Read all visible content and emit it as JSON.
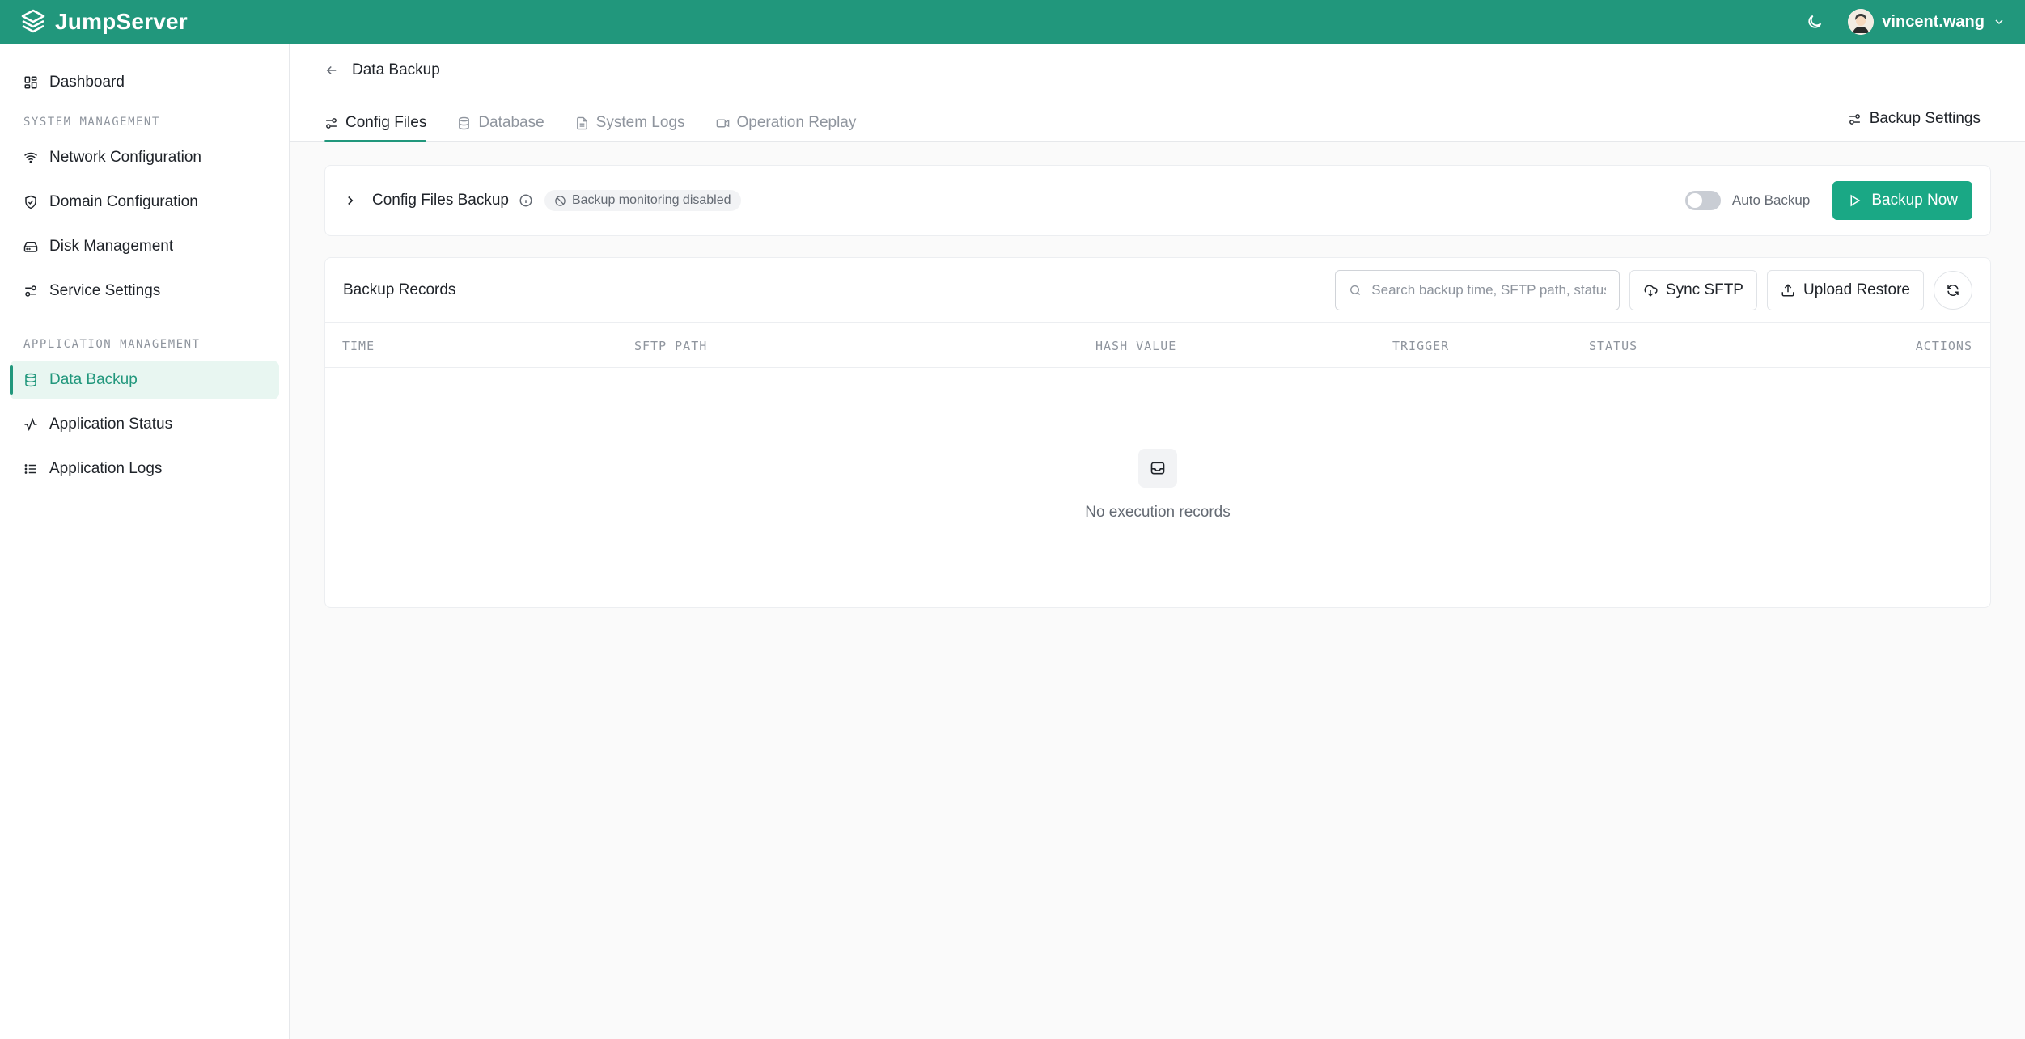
{
  "app": {
    "brand": "JumpServer"
  },
  "header": {
    "username": "vincent.wang"
  },
  "sidebar": {
    "dashboard": "Dashboard",
    "section_system": "SYSTEM MANAGEMENT",
    "system_items": [
      {
        "label": "Network Configuration",
        "icon": "wifi-icon"
      },
      {
        "label": "Domain Configuration",
        "icon": "shield-check-icon"
      },
      {
        "label": "Disk Management",
        "icon": "hard-drive-icon"
      },
      {
        "label": "Service Settings",
        "icon": "sliders-icon"
      }
    ],
    "section_app": "APPLICATION MANAGEMENT",
    "app_items": [
      {
        "label": "Data Backup",
        "icon": "database-icon",
        "active": true
      },
      {
        "label": "Application Status",
        "icon": "activity-icon"
      },
      {
        "label": "Application Logs",
        "icon": "list-icon"
      }
    ]
  },
  "page": {
    "breadcrumb": "Data Backup",
    "tabs": [
      {
        "label": "Config Files",
        "active": true
      },
      {
        "label": "Database"
      },
      {
        "label": "System Logs"
      },
      {
        "label": "Operation Replay"
      }
    ],
    "backup_settings": "Backup Settings"
  },
  "config_card": {
    "title": "Config Files Backup",
    "badge": "Backup monitoring disabled",
    "auto_backup_label": "Auto Backup",
    "auto_backup_on": false,
    "backup_now": "Backup Now"
  },
  "records": {
    "title": "Backup Records",
    "search_placeholder": "Search backup time, SFTP path, status",
    "sync_sftp": "Sync SFTP",
    "upload_restore": "Upload Restore",
    "columns": [
      "TIME",
      "SFTP PATH",
      "HASH VALUE",
      "TRIGGER",
      "STATUS",
      "ACTIONS"
    ],
    "empty_text": "No execution records"
  },
  "colors": {
    "brand": "#21977c",
    "primary_button": "#1aa885",
    "active_bg": "#e8f6f1"
  }
}
